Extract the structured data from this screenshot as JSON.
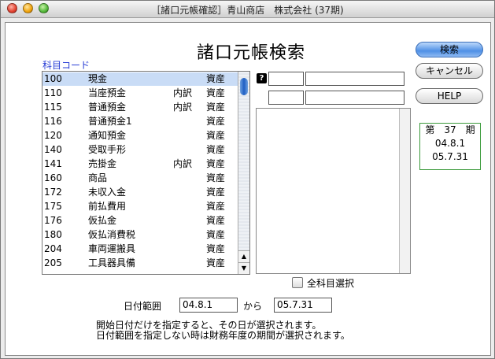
{
  "window": {
    "title": "［諸口元帳確認］青山商店　株式会社 (37期)"
  },
  "page_title": "諸口元帳検索",
  "section_label": "科目コード",
  "accounts": [
    {
      "code": "100",
      "name": "現金",
      "sub": "",
      "type": "資産",
      "selected": true
    },
    {
      "code": "110",
      "name": "当座預金",
      "sub": "内訳",
      "type": "資産"
    },
    {
      "code": "115",
      "name": "普通預金",
      "sub": "内訳",
      "type": "資産"
    },
    {
      "code": "116",
      "name": "普通預金1",
      "sub": "",
      "type": "資産"
    },
    {
      "code": "120",
      "name": "通知預金",
      "sub": "",
      "type": "資産"
    },
    {
      "code": "140",
      "name": "受取手形",
      "sub": "",
      "type": "資産"
    },
    {
      "code": "141",
      "name": "売掛金",
      "sub": "内訳",
      "type": "資産"
    },
    {
      "code": "160",
      "name": "商品",
      "sub": "",
      "type": "資産"
    },
    {
      "code": "172",
      "name": "未収入金",
      "sub": "",
      "type": "資産"
    },
    {
      "code": "175",
      "name": "前払費用",
      "sub": "",
      "type": "資産"
    },
    {
      "code": "176",
      "name": "仮払金",
      "sub": "",
      "type": "資産"
    },
    {
      "code": "180",
      "name": "仮払消費税",
      "sub": "",
      "type": "資産"
    },
    {
      "code": "204",
      "name": "車両運搬具",
      "sub": "",
      "type": "資産"
    },
    {
      "code": "205",
      "name": "工具器具備",
      "sub": "",
      "type": "資産"
    }
  ],
  "buttons": {
    "search": "検索",
    "cancel": "キャンセル",
    "help": "HELP"
  },
  "period": {
    "label": "第　37　期",
    "start": "04.8.1",
    "end": "05.7.31"
  },
  "all_accounts_label": "全科目選択",
  "date_range": {
    "label": "日付範囲",
    "from": "04.8.1",
    "separator": "から",
    "to": "05.7.31"
  },
  "notes": [
    "開始日付だけを指定すると、その日が選択されます。",
    "日付範囲を指定しない時は財務年度の期間が選択されます。"
  ]
}
